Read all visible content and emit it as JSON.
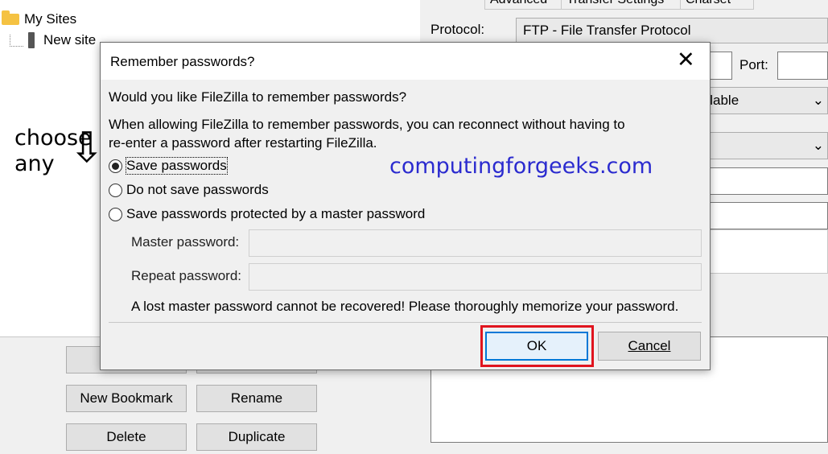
{
  "site_tree": {
    "root_label": "My Sites",
    "child_label": "New site"
  },
  "left_buttons": {
    "new_bookmark": "New Bookmark",
    "rename": "Rename",
    "delete": "Delete",
    "duplicate": "Duplicate"
  },
  "right_panel": {
    "tabs": [
      "Advanced",
      "Transfer Settings",
      "Charset"
    ],
    "protocol_label": "Protocol:",
    "protocol_value": "FTP - File Transfer Protocol",
    "port_label": "Port:",
    "encryption_partial": "ailable"
  },
  "annotation": {
    "line1": "choose",
    "line2": "any",
    "arrow": "⇩"
  },
  "watermark": "computingforgeeks.com",
  "dialog": {
    "title": "Remember passwords?",
    "question": "Would you like FileZilla to remember passwords?",
    "explanation_line1": "When allowing FileZilla to remember passwords, you can reconnect without having to",
    "explanation_line2": "re-enter a password after restarting FileZilla.",
    "options": [
      {
        "label": "Save passwords",
        "selected": true
      },
      {
        "label": "Do not save passwords",
        "selected": false
      },
      {
        "label": "Save passwords protected by a master password",
        "selected": false
      }
    ],
    "master_password_label": "Master password:",
    "repeat_password_label": "Repeat password:",
    "warning": "A lost master password cannot be recovered! Please thoroughly memorize your password.",
    "ok_label": "OK",
    "cancel_label": "Cancel",
    "highlight_color": "#e0141e"
  }
}
